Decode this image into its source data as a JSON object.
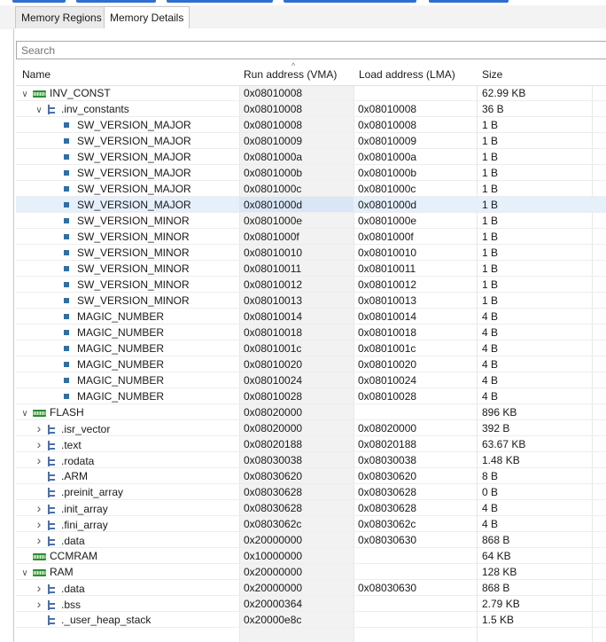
{
  "tabs": [
    {
      "label": "Memory Regions",
      "active": false
    },
    {
      "label": "Memory Details",
      "active": true
    }
  ],
  "search": {
    "placeholder": "Search"
  },
  "columns": {
    "name": "Name",
    "run_address": "Run address (VMA)",
    "load_address": "Load address (LMA)",
    "size": "Size"
  },
  "rows": [
    {
      "level": 0,
      "kind": "region",
      "expander": "expanded",
      "name": "INV_CONST",
      "vma": "0x08010008",
      "lma": "",
      "size": "62.99 KB"
    },
    {
      "level": 1,
      "kind": "section",
      "expander": "expanded",
      "name": ".inv_constants",
      "vma": "0x08010008",
      "lma": "0x08010008",
      "size": "36 B"
    },
    {
      "level": 2,
      "kind": "symbol",
      "expander": "none",
      "name": "SW_VERSION_MAJOR",
      "vma": "0x08010008",
      "lma": "0x08010008",
      "size": "1 B"
    },
    {
      "level": 2,
      "kind": "symbol",
      "expander": "none",
      "name": "SW_VERSION_MAJOR",
      "vma": "0x08010009",
      "lma": "0x08010009",
      "size": "1 B"
    },
    {
      "level": 2,
      "kind": "symbol",
      "expander": "none",
      "name": "SW_VERSION_MAJOR",
      "vma": "0x0801000a",
      "lma": "0x0801000a",
      "size": "1 B"
    },
    {
      "level": 2,
      "kind": "symbol",
      "expander": "none",
      "name": "SW_VERSION_MAJOR",
      "vma": "0x0801000b",
      "lma": "0x0801000b",
      "size": "1 B"
    },
    {
      "level": 2,
      "kind": "symbol",
      "expander": "none",
      "name": "SW_VERSION_MAJOR",
      "vma": "0x0801000c",
      "lma": "0x0801000c",
      "size": "1 B"
    },
    {
      "level": 2,
      "kind": "symbol",
      "expander": "none",
      "name": "SW_VERSION_MAJOR",
      "vma": "0x0801000d",
      "lma": "0x0801000d",
      "size": "1 B",
      "selected": true
    },
    {
      "level": 2,
      "kind": "symbol",
      "expander": "none",
      "name": "SW_VERSION_MINOR",
      "vma": "0x0801000e",
      "lma": "0x0801000e",
      "size": "1 B"
    },
    {
      "level": 2,
      "kind": "symbol",
      "expander": "none",
      "name": "SW_VERSION_MINOR",
      "vma": "0x0801000f",
      "lma": "0x0801000f",
      "size": "1 B"
    },
    {
      "level": 2,
      "kind": "symbol",
      "expander": "none",
      "name": "SW_VERSION_MINOR",
      "vma": "0x08010010",
      "lma": "0x08010010",
      "size": "1 B"
    },
    {
      "level": 2,
      "kind": "symbol",
      "expander": "none",
      "name": "SW_VERSION_MINOR",
      "vma": "0x08010011",
      "lma": "0x08010011",
      "size": "1 B"
    },
    {
      "level": 2,
      "kind": "symbol",
      "expander": "none",
      "name": "SW_VERSION_MINOR",
      "vma": "0x08010012",
      "lma": "0x08010012",
      "size": "1 B"
    },
    {
      "level": 2,
      "kind": "symbol",
      "expander": "none",
      "name": "SW_VERSION_MINOR",
      "vma": "0x08010013",
      "lma": "0x08010013",
      "size": "1 B"
    },
    {
      "level": 2,
      "kind": "symbol",
      "expander": "none",
      "name": "MAGIC_NUMBER",
      "vma": "0x08010014",
      "lma": "0x08010014",
      "size": "4 B"
    },
    {
      "level": 2,
      "kind": "symbol",
      "expander": "none",
      "name": "MAGIC_NUMBER",
      "vma": "0x08010018",
      "lma": "0x08010018",
      "size": "4 B"
    },
    {
      "level": 2,
      "kind": "symbol",
      "expander": "none",
      "name": "MAGIC_NUMBER",
      "vma": "0x0801001c",
      "lma": "0x0801001c",
      "size": "4 B"
    },
    {
      "level": 2,
      "kind": "symbol",
      "expander": "none",
      "name": "MAGIC_NUMBER",
      "vma": "0x08010020",
      "lma": "0x08010020",
      "size": "4 B"
    },
    {
      "level": 2,
      "kind": "symbol",
      "expander": "none",
      "name": "MAGIC_NUMBER",
      "vma": "0x08010024",
      "lma": "0x08010024",
      "size": "4 B"
    },
    {
      "level": 2,
      "kind": "symbol",
      "expander": "none",
      "name": "MAGIC_NUMBER",
      "vma": "0x08010028",
      "lma": "0x08010028",
      "size": "4 B"
    },
    {
      "level": 0,
      "kind": "region",
      "expander": "expanded",
      "name": "FLASH",
      "vma": "0x08020000",
      "lma": "",
      "size": "896 KB"
    },
    {
      "level": 1,
      "kind": "section",
      "expander": "collapsed",
      "name": ".isr_vector",
      "vma": "0x08020000",
      "lma": "0x08020000",
      "size": "392 B"
    },
    {
      "level": 1,
      "kind": "section",
      "expander": "collapsed",
      "name": ".text",
      "vma": "0x08020188",
      "lma": "0x08020188",
      "size": "63.67 KB"
    },
    {
      "level": 1,
      "kind": "section",
      "expander": "collapsed",
      "name": ".rodata",
      "vma": "0x08030038",
      "lma": "0x08030038",
      "size": "1.48 KB"
    },
    {
      "level": 1,
      "kind": "section",
      "expander": "none",
      "name": ".ARM",
      "vma": "0x08030620",
      "lma": "0x08030620",
      "size": "8 B"
    },
    {
      "level": 1,
      "kind": "section",
      "expander": "none",
      "name": ".preinit_array",
      "vma": "0x08030628",
      "lma": "0x08030628",
      "size": "0 B"
    },
    {
      "level": 1,
      "kind": "section",
      "expander": "collapsed",
      "name": ".init_array",
      "vma": "0x08030628",
      "lma": "0x08030628",
      "size": "4 B"
    },
    {
      "level": 1,
      "kind": "section",
      "expander": "collapsed",
      "name": ".fini_array",
      "vma": "0x0803062c",
      "lma": "0x0803062c",
      "size": "4 B"
    },
    {
      "level": 1,
      "kind": "section",
      "expander": "collapsed",
      "name": ".data",
      "vma": "0x20000000",
      "lma": "0x08030630",
      "size": "868 B"
    },
    {
      "level": 0,
      "kind": "region",
      "expander": "none",
      "name": "CCMRAM",
      "vma": "0x10000000",
      "lma": "",
      "size": "64 KB"
    },
    {
      "level": 0,
      "kind": "region",
      "expander": "expanded",
      "name": "RAM",
      "vma": "0x20000000",
      "lma": "",
      "size": "128 KB"
    },
    {
      "level": 1,
      "kind": "section",
      "expander": "collapsed",
      "name": ".data",
      "vma": "0x20000000",
      "lma": "0x08030630",
      "size": "868 B"
    },
    {
      "level": 1,
      "kind": "section",
      "expander": "collapsed",
      "name": ".bss",
      "vma": "0x20000364",
      "lma": "",
      "size": "2.79 KB"
    },
    {
      "level": 1,
      "kind": "section",
      "expander": "none",
      "name": "._user_heap_stack",
      "vma": "0x20000e8c",
      "lma": "",
      "size": "1.5 KB"
    }
  ]
}
